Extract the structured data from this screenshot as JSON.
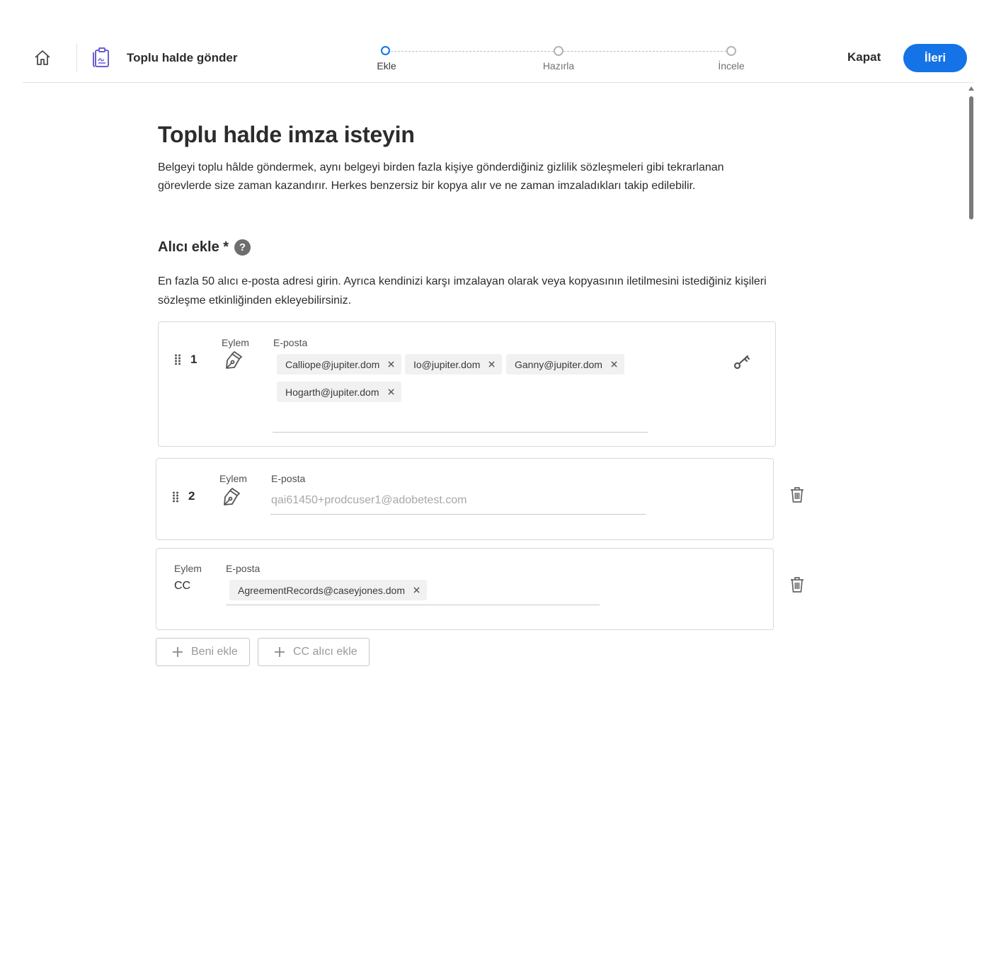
{
  "header": {
    "app_title": "Toplu halde gönder",
    "steps": [
      {
        "label": "Ekle",
        "active": true
      },
      {
        "label": "Hazırla",
        "active": false
      },
      {
        "label": "İncele",
        "active": false
      }
    ],
    "close_label": "Kapat",
    "next_label": "İleri"
  },
  "page": {
    "title": "Toplu halde imza isteyin",
    "description": "Belgeyi toplu hâlde göndermek, aynı belgeyi birden fazla kişiye gönderdiğiniz gizlilik sözleşmeleri gibi tekrarlanan görevlerde size zaman kazandırır. Herkes benzersiz bir kopya alır ve ne zaman imzaladıkları takip edilebilir."
  },
  "recipients": {
    "title": "Alıcı ekle *",
    "help_glyph": "?",
    "description": "En fazla 50 alıcı e-posta adresi girin. Ayrıca kendinizi karşı imzalayan olarak veya kopyasının iletilmesini istediğiniz kişileri sözleşme etkinliğinden ekleyebilirsiniz.",
    "action_label": "Eylem",
    "email_label": "E-posta",
    "row1": {
      "order": "1",
      "chips": [
        "Calliope@jupiter.dom",
        "Io@jupiter.dom",
        "Ganny@jupiter.dom",
        "Hogarth@jupiter.dom"
      ]
    },
    "row2": {
      "order": "2",
      "placeholder": "qai61450+prodcuser1@adobetest.com"
    },
    "cc_row": {
      "action_value": "CC",
      "chips": [
        "AgreementRecords@caseyjones.dom"
      ]
    },
    "add_me_label": "Beni ekle",
    "add_cc_label": "CC alıcı ekle"
  },
  "colors": {
    "accent": "#1473e6",
    "chip_bg": "#f1f1f1",
    "icon_gray": "#6e6e6e"
  }
}
